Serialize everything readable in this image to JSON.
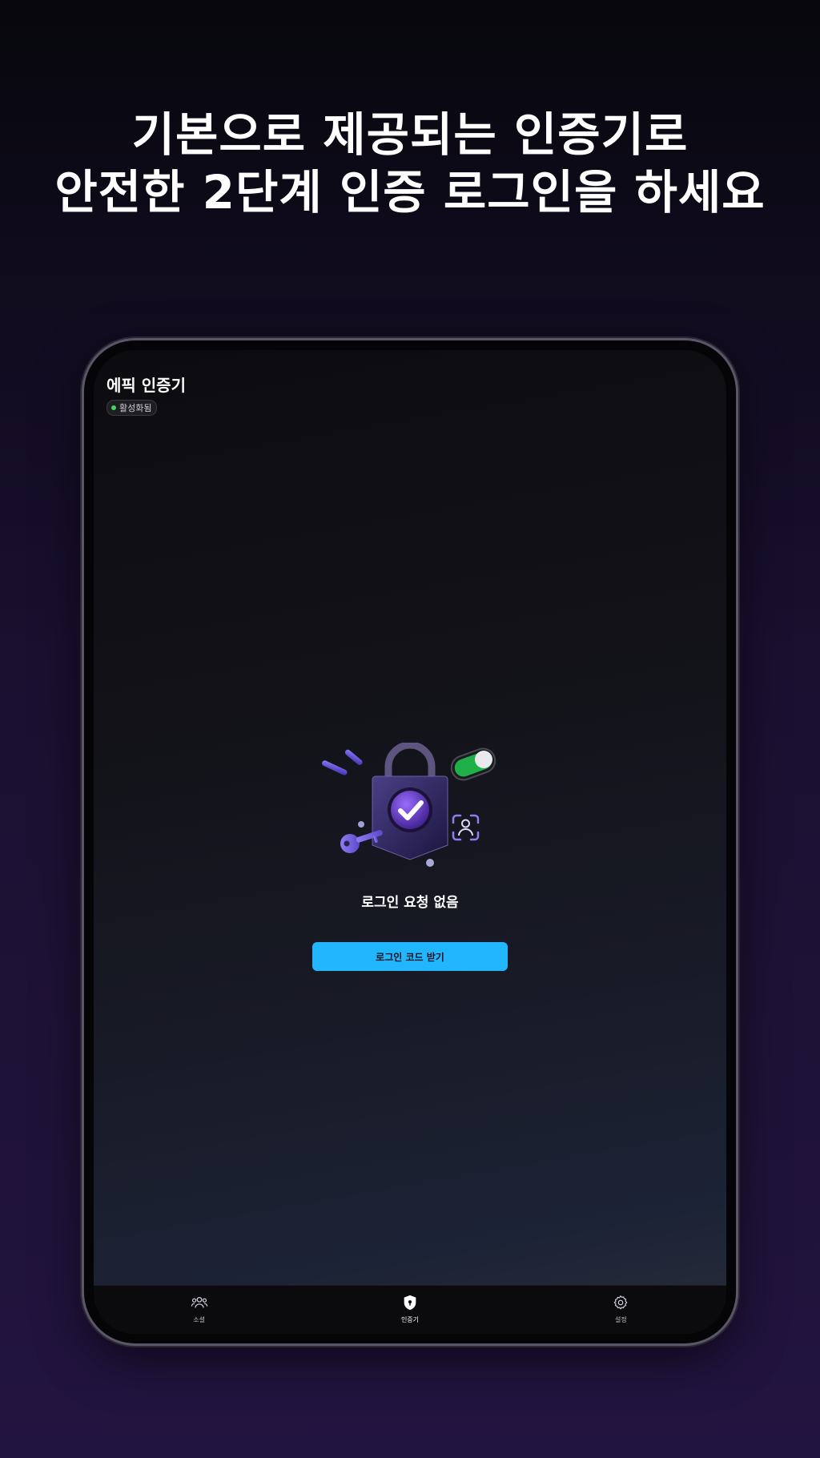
{
  "headline": {
    "line1": "기본으로 제공되는 인증기로",
    "line2": "안전한 2단계 인증 로그인을 하세요"
  },
  "app": {
    "title": "에픽 인증기",
    "status_label": "활성화됨",
    "status_color": "#3fd45a"
  },
  "main": {
    "empty_text": "로그인 요청 없음",
    "button_label": "로그인 코드 받기",
    "accent_color": "#22b6ff"
  },
  "bottom_nav": {
    "items": [
      {
        "label": "소셜",
        "icon": "people-icon"
      },
      {
        "label": "인증기",
        "icon": "shield-icon",
        "active": true
      },
      {
        "label": "설정",
        "icon": "gear-icon"
      }
    ]
  }
}
